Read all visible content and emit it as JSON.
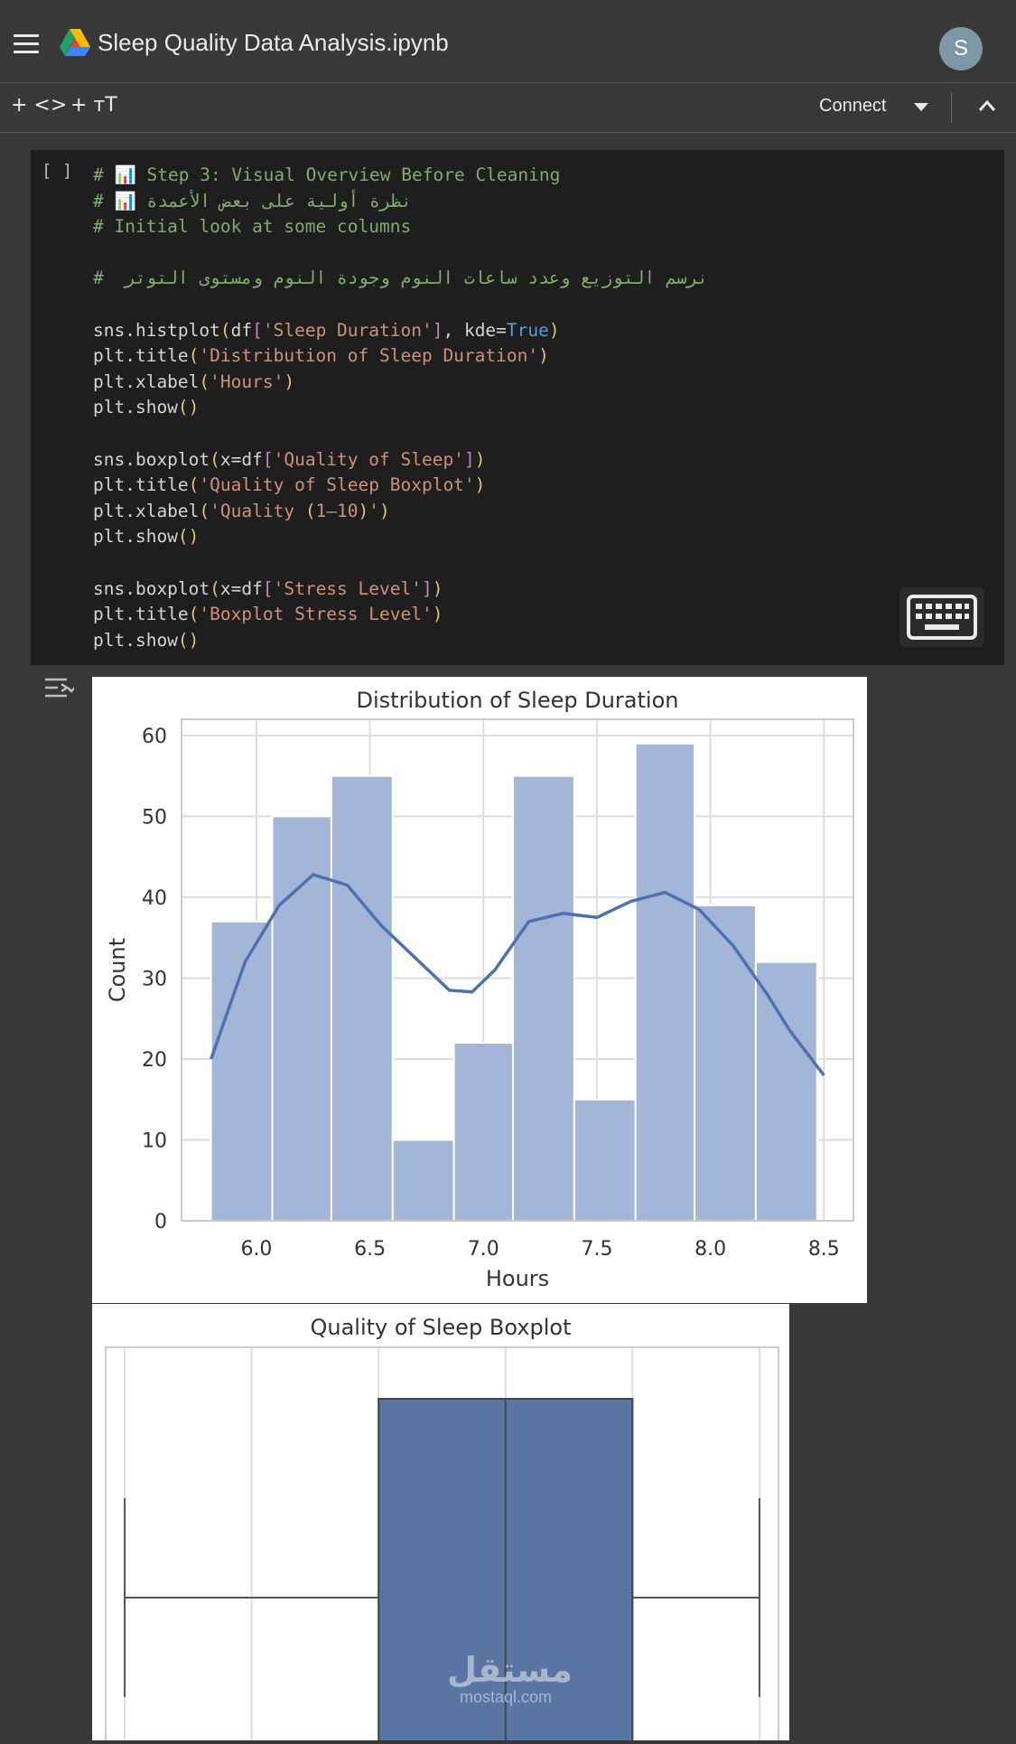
{
  "header": {
    "title": "Sleep Quality Data Analysis.ipynb",
    "avatar_letter": "S",
    "icons": {
      "menu": "menu-icon",
      "drive": "drive-logo-icon"
    }
  },
  "toolbar": {
    "add_code_label": "+ <>",
    "add_text_label": "+ тT",
    "connect_label": "Connect"
  },
  "cell": {
    "bracket": "[ ]",
    "code_lines": [
      "# 📊 Step 3: Visual Overview Before Cleaning",
      "# 📊 نظرة أولية على بعض الأعمدة",
      "# Initial look at some columns",
      "",
      "#  نرسم التوزيع وعدد ساعات النوم وجودة النوم ومستوى التوتر",
      "",
      "sns.histplot(df['Sleep Duration'], kde=True)",
      "plt.title('Distribution of Sleep Duration')",
      "plt.xlabel('Hours')",
      "plt.show()",
      "",
      "sns.boxplot(x=df['Quality of Sleep'])",
      "plt.title('Quality of Sleep Boxplot')",
      "plt.xlabel('Quality (1–10)')",
      "plt.show()",
      "",
      "sns.boxplot(x=df['Stress Level'])",
      "plt.title('Boxplot Stress Level')",
      "plt.show()"
    ]
  },
  "chart_data": [
    {
      "type": "bar",
      "title": "Distribution of Sleep Duration",
      "xlabel": "Hours",
      "ylabel": "Count",
      "bins": [
        {
          "x0": 5.8,
          "x1": 6.07,
          "count": 37
        },
        {
          "x0": 6.07,
          "x1": 6.33,
          "count": 50
        },
        {
          "x0": 6.33,
          "x1": 6.6,
          "count": 55
        },
        {
          "x0": 6.6,
          "x1": 6.87,
          "count": 10
        },
        {
          "x0": 6.87,
          "x1": 7.13,
          "count": 22
        },
        {
          "x0": 7.13,
          "x1": 7.4,
          "count": 55
        },
        {
          "x0": 7.4,
          "x1": 7.67,
          "count": 15
        },
        {
          "x0": 7.67,
          "x1": 7.93,
          "count": 59
        },
        {
          "x0": 7.93,
          "x1": 8.2,
          "count": 39
        },
        {
          "x0": 8.2,
          "x1": 8.47,
          "count": 32
        }
      ],
      "kde": [
        [
          5.8,
          20
        ],
        [
          5.95,
          32
        ],
        [
          6.1,
          39
        ],
        [
          6.25,
          42.8
        ],
        [
          6.4,
          41.5
        ],
        [
          6.55,
          36.5
        ],
        [
          6.7,
          32.5
        ],
        [
          6.85,
          28.5
        ],
        [
          6.95,
          28.3
        ],
        [
          7.05,
          31
        ],
        [
          7.2,
          37
        ],
        [
          7.35,
          38
        ],
        [
          7.5,
          37.5
        ],
        [
          7.65,
          39.5
        ],
        [
          7.8,
          40.6
        ],
        [
          7.95,
          38.5
        ],
        [
          8.1,
          34
        ],
        [
          8.25,
          28
        ],
        [
          8.35,
          23.5
        ],
        [
          8.5,
          18
        ]
      ],
      "xticks": [
        "6.0",
        "6.5",
        "7.0",
        "7.5",
        "8.0",
        "8.5"
      ],
      "yticks": [
        "0",
        "10",
        "20",
        "30",
        "40",
        "50",
        "60"
      ],
      "xlim": [
        5.67,
        8.63
      ],
      "ylim": [
        0,
        62
      ],
      "grid": true,
      "color": "#4c72b0"
    },
    {
      "type": "boxplot",
      "title": "Quality of Sleep Boxplot",
      "xlim": [
        3.85,
        9.15
      ],
      "whisker_low": 4,
      "q1": 6,
      "median": 7,
      "q3": 8,
      "whisker_high": 9,
      "grid": true,
      "color": "#5875a4"
    }
  ],
  "watermark": {
    "brand": "مستقل",
    "domain": "mostaql.com"
  }
}
